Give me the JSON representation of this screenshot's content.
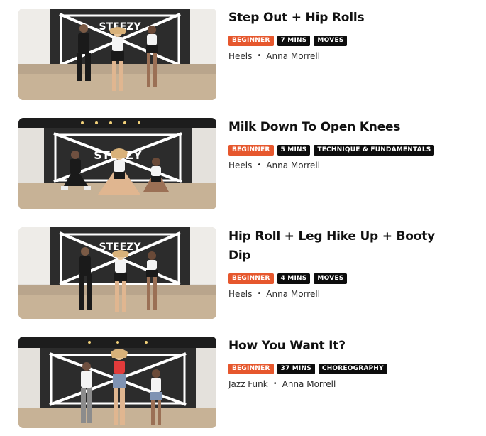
{
  "classes": [
    {
      "title": "Step Out + Hip Rolls",
      "level": "BEGINNER",
      "duration": "7 MINS",
      "category": "MOVES",
      "style": "Heels",
      "separator": "•",
      "instructor": "Anna Morrell"
    },
    {
      "title": "Milk Down To Open Knees",
      "level": "BEGINNER",
      "duration": "5 MINS",
      "category": "TECHNIQUE & FUNDAMENTALS",
      "style": "Heels",
      "separator": "•",
      "instructor": "Anna Morrell"
    },
    {
      "title": "Hip Roll + Leg Hike Up + Booty Dip",
      "level": "BEGINNER",
      "duration": "4 MINS",
      "category": "MOVES",
      "style": "Heels",
      "separator": "•",
      "instructor": "Anna Morrell"
    },
    {
      "title": "How You Want It?",
      "level": "BEGINNER",
      "duration": "37 MINS",
      "category": "CHOREOGRAPHY",
      "style": "Jazz Funk",
      "separator": "•",
      "instructor": "Anna Morrell"
    }
  ],
  "thumbnail_wall_text": "STEEZY",
  "colors": {
    "level_badge": "#e6572d",
    "tag_badge": "#0d0d0d"
  }
}
